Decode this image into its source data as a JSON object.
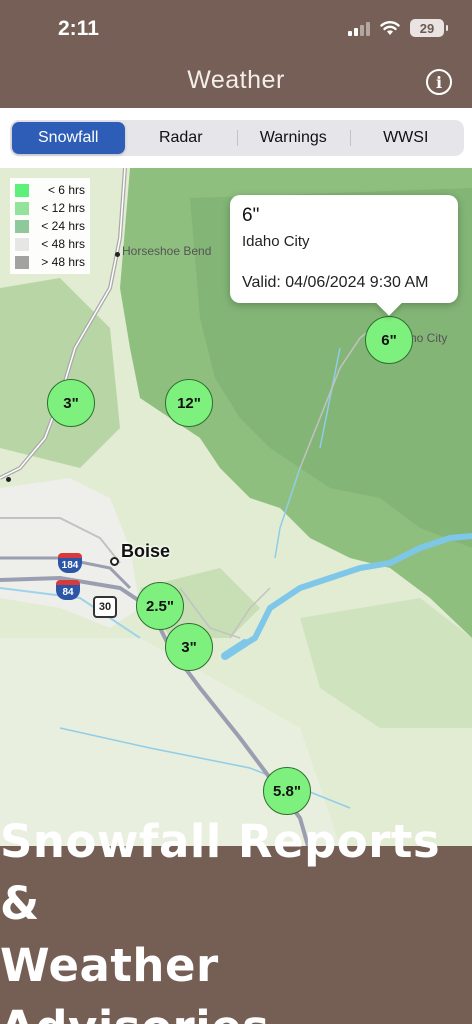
{
  "status_bar": {
    "time": "2:11",
    "battery": "29"
  },
  "header": {
    "title": "Weather",
    "info_icon": "info-icon"
  },
  "tabs": [
    {
      "label": "Snowfall",
      "active": true
    },
    {
      "label": "Radar",
      "active": false
    },
    {
      "label": "Warnings",
      "active": false
    },
    {
      "label": "WWSI",
      "active": false
    }
  ],
  "legend": [
    {
      "label": "< 6 hrs",
      "color": "#5cf27a"
    },
    {
      "label": "< 12 hrs",
      "color": "#93e39a"
    },
    {
      "label": "< 24 hrs",
      "color": "#8fc89a"
    },
    {
      "label": "< 48 hrs",
      "color": "#e6e6e6"
    },
    {
      "label": "> 48 hrs",
      "color": "#a2a2a2"
    }
  ],
  "map": {
    "places": {
      "horseshoe_bend": "Horseshoe Bend",
      "boise": "Boise",
      "idaho_city_label": "ho City"
    },
    "shields": {
      "i184": "184",
      "i84": "84",
      "us30": "30"
    },
    "markers": [
      {
        "label": "6\""
      },
      {
        "label": "3\""
      },
      {
        "label": "12\""
      },
      {
        "label": "2.5\""
      },
      {
        "label": "3\""
      },
      {
        "label": "5.8\""
      }
    ],
    "marker_color": "#7ef07e",
    "callout": {
      "amount": "6\"",
      "city": "Idaho City",
      "valid": "Valid: 04/06/2024 9:30 AM"
    }
  },
  "banner": {
    "line1": "Snowfall Reports &",
    "line2": "Weather Advisories"
  },
  "colors": {
    "brand_brown": "#765f56",
    "active_tab": "#2d5db6"
  }
}
